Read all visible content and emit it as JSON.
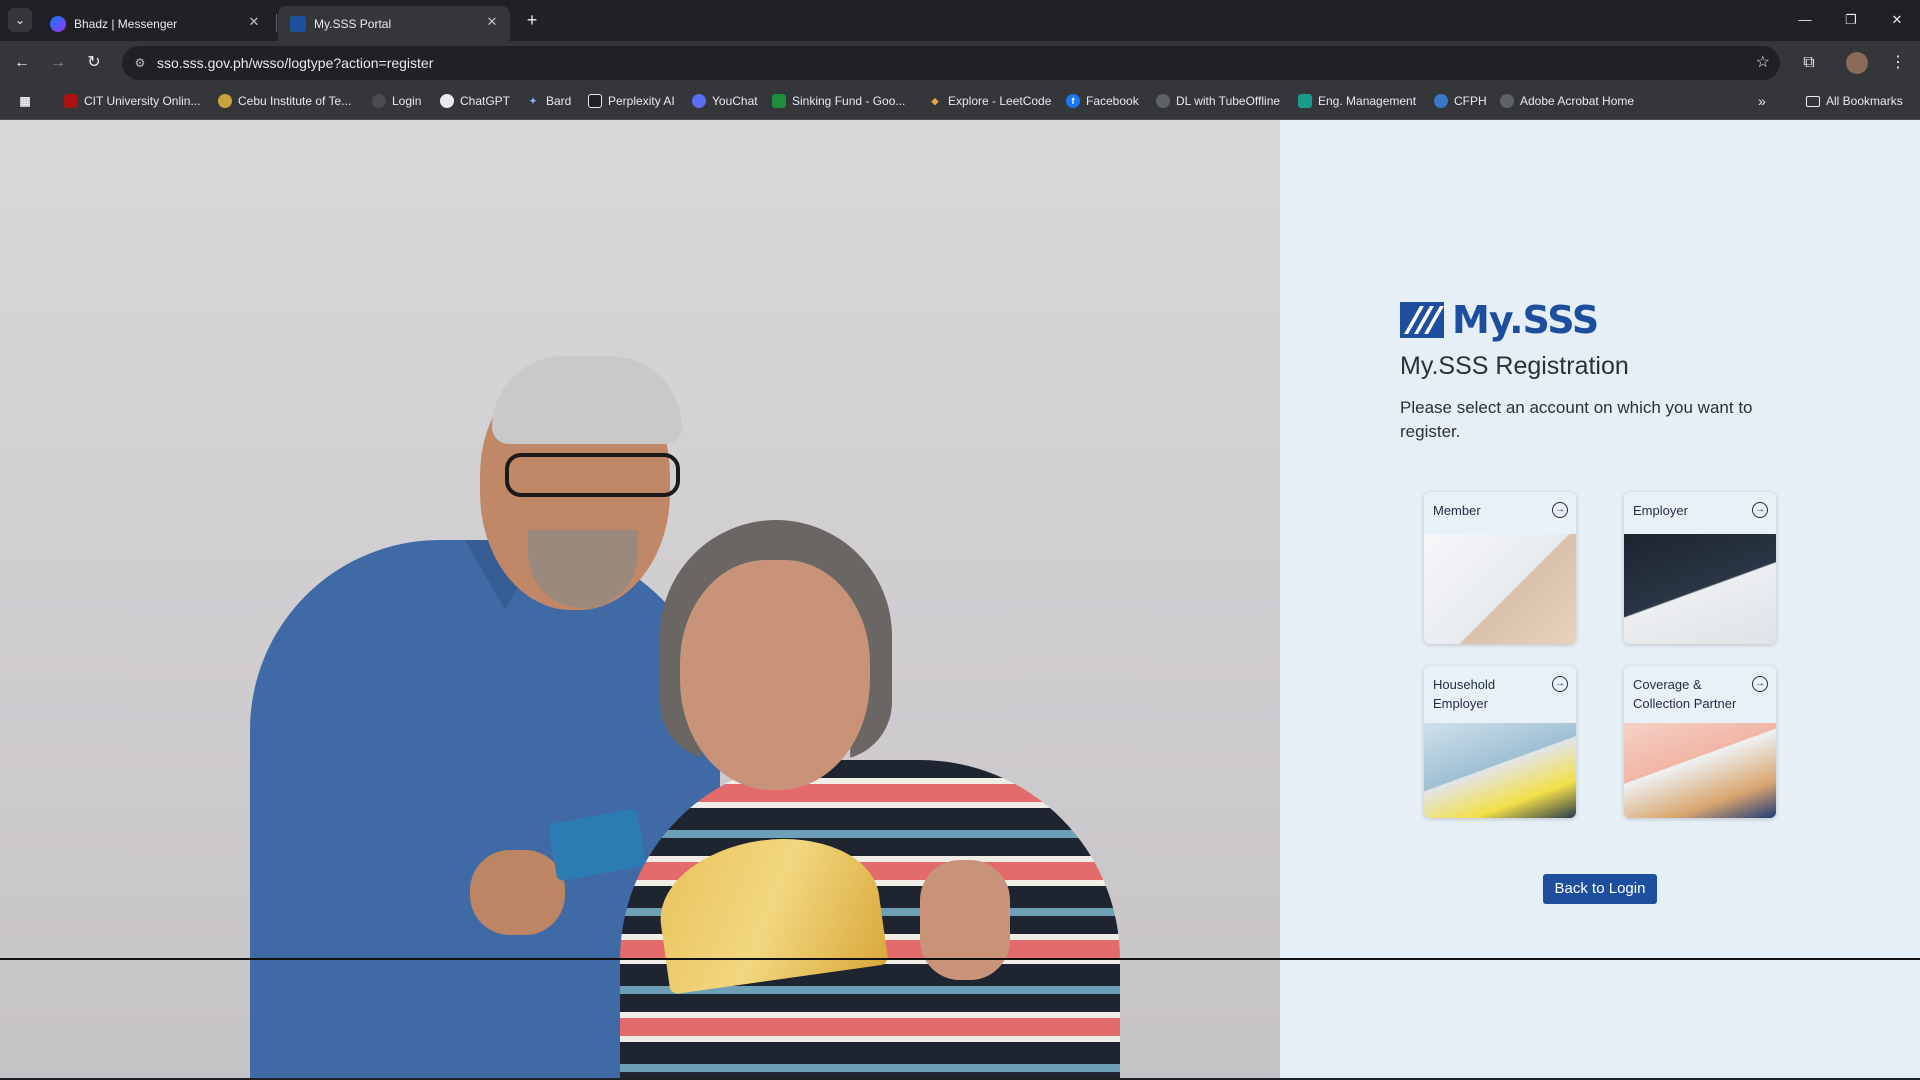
{
  "browser": {
    "tabs": [
      {
        "title": "Bhadz | Messenger",
        "favicon": "messenger-icon",
        "active": false
      },
      {
        "title": "My.SSS Portal",
        "favicon": "sss-icon",
        "active": true
      }
    ],
    "url": "sso.sss.gov.ph/wsso/logtype?action=register",
    "bookmarks": [
      {
        "label": "CIT University Onlin...",
        "icon": "cit-icon"
      },
      {
        "label": "Cebu Institute of Te...",
        "icon": "cit-seal-icon"
      },
      {
        "label": "Login",
        "icon": "login-icon"
      },
      {
        "label": "ChatGPT",
        "icon": "chatgpt-icon"
      },
      {
        "label": "Bard",
        "icon": "bard-icon"
      },
      {
        "label": "Perplexity AI",
        "icon": "perplexity-icon"
      },
      {
        "label": "YouChat",
        "icon": "youchat-icon"
      },
      {
        "label": "Sinking Fund - Goo...",
        "icon": "sheets-icon"
      },
      {
        "label": "Explore - LeetCode",
        "icon": "leetcode-icon"
      },
      {
        "label": "Facebook",
        "icon": "facebook-icon"
      },
      {
        "label": "DL with TubeOffline",
        "icon": "globe-icon"
      },
      {
        "label": "Eng. Management",
        "icon": "classroom-icon"
      },
      {
        "label": "CFPH",
        "icon": "cfph-icon"
      },
      {
        "label": "Adobe Acrobat Home",
        "icon": "globe-icon"
      }
    ],
    "all_bookmarks_label": "All Bookmarks"
  },
  "page": {
    "brand": "My.SSS",
    "title": "My.SSS Registration",
    "instructions": "Please select an account on which you want to register.",
    "cards": [
      {
        "label": "Member"
      },
      {
        "label": "Employer"
      },
      {
        "label": "Household Employer"
      },
      {
        "label": "Coverage & Collection Partner"
      }
    ],
    "back_button": "Back to Login",
    "accent_color": "#1d4f9e"
  }
}
